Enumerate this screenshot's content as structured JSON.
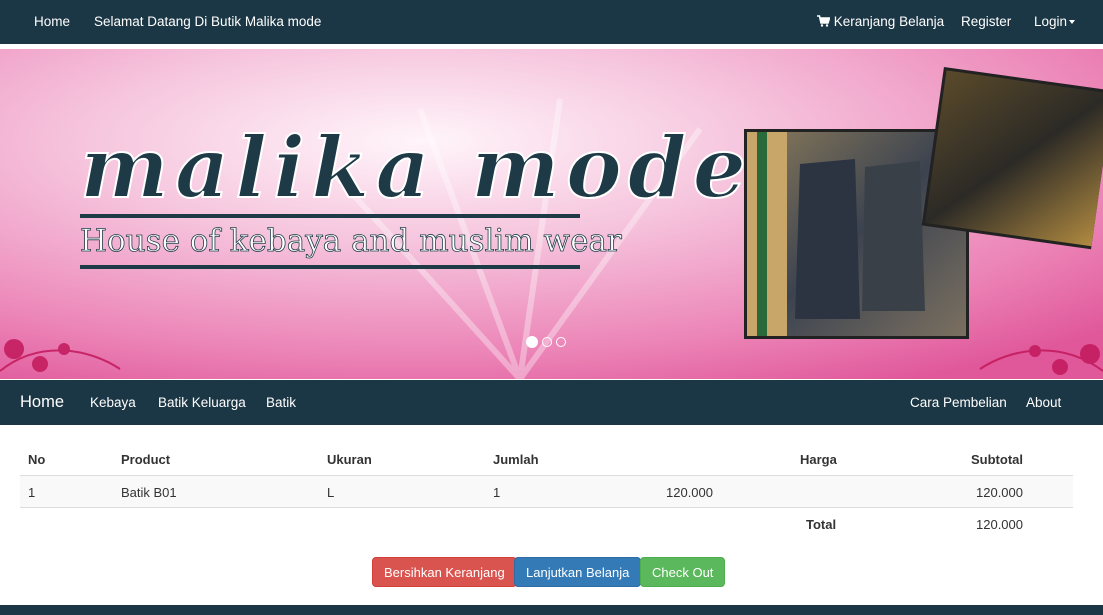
{
  "topnav": {
    "home": "Home",
    "welcome": "Selamat Datang Di Butik Malika mode",
    "cart": "Keranjang Belanja",
    "register": "Register",
    "login": "Login"
  },
  "banner": {
    "logo_text": "malika mode",
    "tagline": "House of kebaya and muslim wear",
    "slides_count": 3,
    "active_slide": 1
  },
  "mainnav": {
    "brand": "Home",
    "items": [
      "Kebaya",
      "Batik Keluarga",
      "Batik"
    ],
    "right_items": [
      "Cara Pembelian",
      "About"
    ]
  },
  "cart": {
    "headers": [
      "No",
      "Product",
      "Ukuran",
      "Jumlah",
      "Harga",
      "Subtotal"
    ],
    "rows": [
      {
        "no": "1",
        "product": "Batik B01",
        "ukuran": "L",
        "jumlah": "1",
        "harga": "120.000",
        "subtotal": "120.000"
      }
    ],
    "total_label": "Total",
    "total_value": "120.000"
  },
  "buttons": {
    "clear": "Bersihkan Keranjang",
    "continue": "Lanjutkan Belanja",
    "checkout": "Check Out"
  },
  "colors": {
    "navbar": "#1b3644",
    "banner_pink": "#ec7fb2",
    "danger": "#d9534f",
    "primary": "#337ab7",
    "success": "#5cb85c"
  }
}
